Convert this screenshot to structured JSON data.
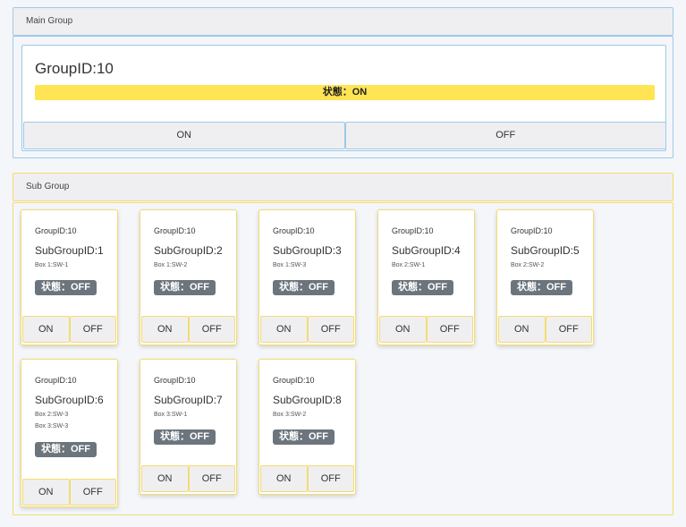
{
  "main_group": {
    "header": "Main Group",
    "title": "GroupID:10",
    "status": "状態：ON",
    "status_color": "#ffe453",
    "on_label": "ON",
    "off_label": "OFF"
  },
  "sub_group": {
    "header": "Sub Group",
    "cards": [
      {
        "group": "GroupID:10",
        "sub": "SubGroupID:1",
        "boxes": [
          "Box 1:SW-1"
        ],
        "status": "状態：OFF",
        "on": "ON",
        "off": "OFF"
      },
      {
        "group": "GroupID:10",
        "sub": "SubGroupID:2",
        "boxes": [
          "Box 1:SW-2"
        ],
        "status": "状態：OFF",
        "on": "ON",
        "off": "OFF"
      },
      {
        "group": "GroupID:10",
        "sub": "SubGroupID:3",
        "boxes": [
          "Box 1:SW-3"
        ],
        "status": "状態：OFF",
        "on": "ON",
        "off": "OFF"
      },
      {
        "group": "GroupID:10",
        "sub": "SubGroupID:4",
        "boxes": [
          "Box 2:SW-1"
        ],
        "status": "状態：OFF",
        "on": "ON",
        "off": "OFF"
      },
      {
        "group": "GroupID:10",
        "sub": "SubGroupID:5",
        "boxes": [
          "Box 2:SW-2"
        ],
        "status": "状態：OFF",
        "on": "ON",
        "off": "OFF"
      },
      {
        "group": "GroupID:10",
        "sub": "SubGroupID:6",
        "boxes": [
          "Box 2:SW-3",
          "Box 3:SW-3"
        ],
        "status": "状態：OFF",
        "on": "ON",
        "off": "OFF"
      },
      {
        "group": "GroupID:10",
        "sub": "SubGroupID:7",
        "boxes": [
          "Box 3:SW-1"
        ],
        "status": "状態：OFF",
        "on": "ON",
        "off": "OFF"
      },
      {
        "group": "GroupID:10",
        "sub": "SubGroupID:8",
        "boxes": [
          "Box 3:SW-2"
        ],
        "status": "状態：OFF",
        "on": "ON",
        "off": "OFF"
      }
    ]
  }
}
